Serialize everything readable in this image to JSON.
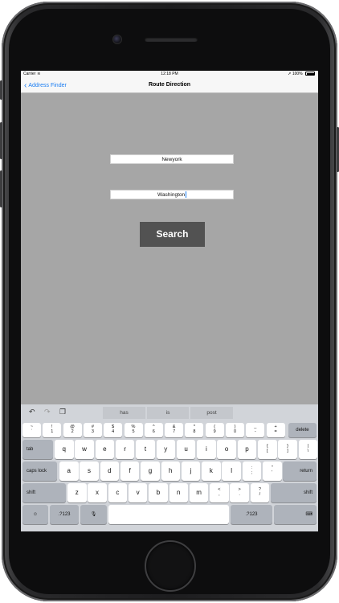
{
  "status_bar": {
    "carrier": "Carrier",
    "wifi_icon": "wifi-icon",
    "time": "12:18 PM",
    "battery_percent": "100%",
    "battery_level": 1.0
  },
  "nav": {
    "back_label": "Address Finder",
    "title": "Route Direction"
  },
  "form": {
    "from_value": "Newyork",
    "to_value": "Washington",
    "search_label": "Search"
  },
  "keyboard": {
    "toolbar_icons": [
      "undo-icon",
      "redo-icon",
      "paste-icon"
    ],
    "suggestions": [
      "has",
      "is",
      "post"
    ],
    "number_row": [
      {
        "top": "~",
        "bottom": "`"
      },
      {
        "top": "!",
        "bottom": "1"
      },
      {
        "top": "@",
        "bottom": "2"
      },
      {
        "top": "#",
        "bottom": "3"
      },
      {
        "top": "$",
        "bottom": "4"
      },
      {
        "top": "%",
        "bottom": "5"
      },
      {
        "top": "^",
        "bottom": "6"
      },
      {
        "top": "&",
        "bottom": "7"
      },
      {
        "top": "*",
        "bottom": "8"
      },
      {
        "top": "(",
        "bottom": "9"
      },
      {
        "top": ")",
        "bottom": "0"
      },
      {
        "top": "_",
        "bottom": "-"
      },
      {
        "top": "+",
        "bottom": "="
      }
    ],
    "delete_label": "delete",
    "tab_label": "tab",
    "row_q": [
      "q",
      "w",
      "e",
      "r",
      "t",
      "y",
      "u",
      "i",
      "o",
      "p"
    ],
    "row_q_symbols": [
      {
        "top": "{",
        "bottom": "["
      },
      {
        "top": "}",
        "bottom": "]"
      },
      {
        "top": "|",
        "bottom": "\\"
      }
    ],
    "caps_label": "caps lock",
    "row_a": [
      "a",
      "s",
      "d",
      "f",
      "g",
      "h",
      "j",
      "k",
      "l"
    ],
    "row_a_symbols": [
      {
        "top": ":",
        "bottom": ";"
      },
      {
        "top": "\"",
        "bottom": "'"
      }
    ],
    "return_label": "return",
    "shift_label": "shift",
    "row_z": [
      "z",
      "x",
      "c",
      "v",
      "b",
      "n",
      "m"
    ],
    "row_z_symbols": [
      {
        "top": "<",
        "bottom": ","
      },
      {
        "top": ">",
        "bottom": "."
      },
      {
        "top": "?",
        "bottom": "/"
      }
    ],
    "emoji_icon": "emoji-icon",
    "numbers_label": ".?123",
    "mic_icon": "microphone-icon",
    "hide_keyboard_icon": "keyboard-hide-icon"
  }
}
